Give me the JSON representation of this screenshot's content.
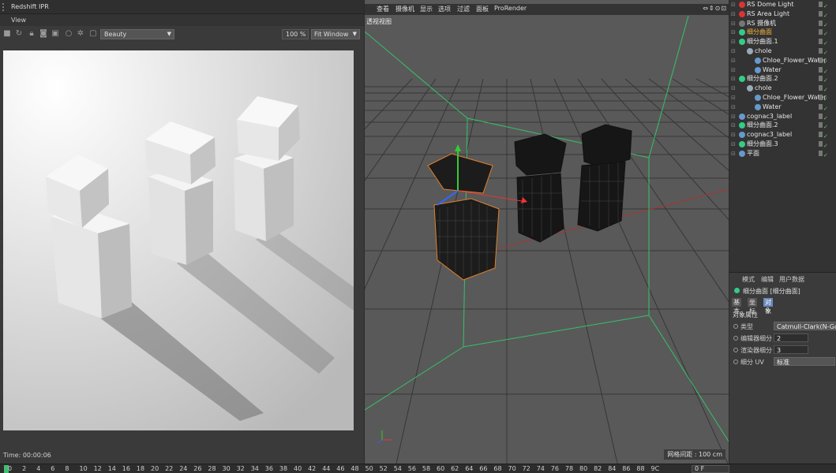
{
  "ipr": {
    "title": "Redshift IPR",
    "menu_view": "View",
    "aov": "Beauty",
    "zoom": "100 %",
    "fit": "Fit Window",
    "time": "Time: 00:00:06"
  },
  "viewport": {
    "menu": [
      "查看",
      "摄像机",
      "显示",
      "选项",
      "过滤",
      "面板",
      "ProRender"
    ],
    "label": "透视视图",
    "grid_info": "网格间距 : 100 cm",
    "controls": "⇔⇕⊙⊡"
  },
  "objects": [
    {
      "name": "RS Dome Light",
      "indent": 0,
      "icon": "light-icon",
      "color": "#d33",
      "selected": false
    },
    {
      "name": "RS Area Light",
      "indent": 0,
      "icon": "light-icon",
      "color": "#d33",
      "selected": false
    },
    {
      "name": "RS 摄像机",
      "indent": 0,
      "icon": "camera-icon",
      "color": "#777",
      "selected": false
    },
    {
      "name": "细分曲面",
      "indent": 0,
      "icon": "subdivision-icon",
      "color": "#3c8",
      "selected": true
    },
    {
      "name": "细分曲面.1",
      "indent": 0,
      "icon": "subdivision-icon",
      "color": "#3c8",
      "selected": false
    },
    {
      "name": "chole",
      "indent": 1,
      "icon": "null-icon",
      "color": "#9ab",
      "selected": false
    },
    {
      "name": "Chloe_Flower_Water",
      "indent": 2,
      "icon": "polygon-icon",
      "color": "#69c",
      "selected": false
    },
    {
      "name": "Water",
      "indent": 2,
      "icon": "polygon-icon",
      "color": "#69c",
      "selected": false
    },
    {
      "name": "细分曲面.2",
      "indent": 0,
      "icon": "subdivision-icon",
      "color": "#3c8",
      "selected": false
    },
    {
      "name": "chole",
      "indent": 1,
      "icon": "null-icon",
      "color": "#9ab",
      "selected": false
    },
    {
      "name": "Chloe_Flower_Water",
      "indent": 2,
      "icon": "polygon-icon",
      "color": "#69c",
      "selected": false
    },
    {
      "name": "Water",
      "indent": 2,
      "icon": "polygon-icon",
      "color": "#69c",
      "selected": false
    },
    {
      "name": "cognac3_label",
      "indent": 0,
      "icon": "polygon-icon",
      "color": "#69c",
      "selected": false
    },
    {
      "name": "细分曲面.2",
      "indent": 0,
      "icon": "subdivision-icon",
      "color": "#3c8",
      "selected": false
    },
    {
      "name": "cognac3_label",
      "indent": 0,
      "icon": "polygon-icon",
      "color": "#69c",
      "selected": false
    },
    {
      "name": "细分曲面.3",
      "indent": 0,
      "icon": "subdivision-icon",
      "color": "#3c8",
      "selected": false
    },
    {
      "name": "平面",
      "indent": 0,
      "icon": "plane-icon",
      "color": "#69c",
      "selected": false
    }
  ],
  "attributes": {
    "menu": [
      "模式",
      "编辑",
      "用户数据"
    ],
    "title": "细分曲面 [细分曲面]",
    "tabs": [
      "基本",
      "坐标",
      "对象"
    ],
    "active_tab": "对象",
    "section": "对象属性",
    "props": [
      {
        "label": "类型",
        "value": "Catmull-Clark(N-Gons)"
      },
      {
        "label": "编辑器细分",
        "value": "2"
      },
      {
        "label": "渲染器细分",
        "value": "3"
      },
      {
        "label": "细分 UV",
        "value": "标准"
      }
    ]
  },
  "timeline": {
    "ticks": [
      "0",
      "2",
      "4",
      "6",
      "8",
      "10",
      "12",
      "14",
      "16",
      "18",
      "20",
      "22",
      "24",
      "26",
      "28",
      "30",
      "32",
      "34",
      "36",
      "38",
      "40",
      "42",
      "44",
      "46",
      "48",
      "50",
      "52",
      "54",
      "56",
      "58",
      "60",
      "62",
      "64",
      "66",
      "68",
      "70",
      "72",
      "74",
      "76",
      "78",
      "80",
      "82",
      "84",
      "86",
      "88",
      "9C"
    ],
    "frame": "0 F"
  },
  "colors": {
    "accent": "#6b8bbd",
    "selected_text": "#f3b33d",
    "timeline_cursor": "#3fbf6f",
    "viewport_bg": "#595959",
    "bounding_green": "#36c26a",
    "selection_orange": "#e0802a"
  }
}
